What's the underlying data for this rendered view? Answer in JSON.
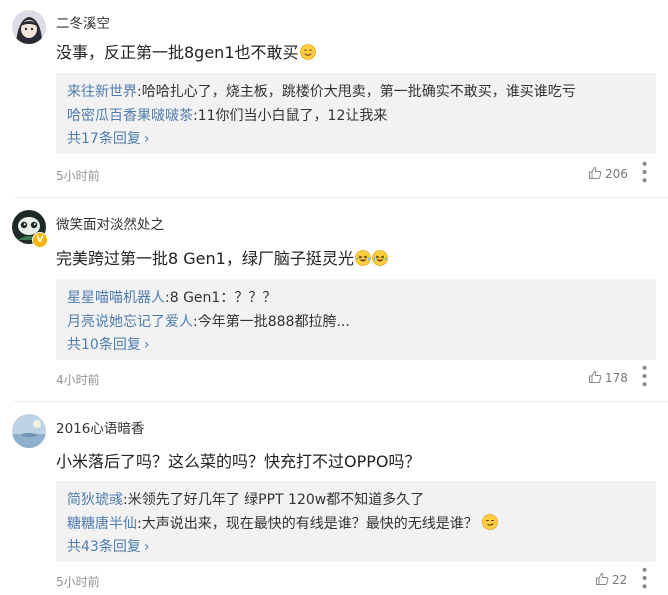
{
  "comments": [
    {
      "username": "二冬溪空",
      "content": "没事，反正第一批8gen1也不敢买",
      "content_emoji": "smile-emoji",
      "replies": [
        {
          "user": "来往新世界",
          "sep": ":",
          "text": "哈哈扎心了，烧主板，跳楼价大甩卖，第一批确实不敢买，谁买谁吃亏"
        },
        {
          "user": "哈密瓜百香果啵啵茶",
          "sep": ":",
          "text": "11你们当小白鼠了，12让我来"
        }
      ],
      "more_replies": "共17条回复",
      "time": "5小时前",
      "likes": "206"
    },
    {
      "username": "微笑面对淡然处之",
      "content": "完美跨过第一批8 Gen1，绿厂脑子挺灵光",
      "content_emoji": "laugh-cry-emoji",
      "verified": "V",
      "replies": [
        {
          "user": "星星喵喵机器人",
          "sep": ":",
          "text": "8 Gen1：？？？"
        },
        {
          "user": "月亮说她忘记了爱人",
          "sep": ":",
          "text": "今年第一批888都拉胯..."
        }
      ],
      "more_replies": "共10条回复",
      "time": "4小时前",
      "likes": "178"
    },
    {
      "username": "2016心语暗香",
      "content": "小米落后了吗？这么菜的吗？快充打不过OPPO吗？",
      "replies": [
        {
          "user": "简狄琥彧",
          "sep": ":",
          "text": "米领先了好几年了 绿PPT 120w都不知道多久了"
        },
        {
          "user": "糖糖唐半仙",
          "sep": ":",
          "text": "大声说出来，现在最快的有线是谁？最快的无线是谁？"
        }
      ],
      "more_replies": "共43条回复",
      "time": "5小时前",
      "likes": "22"
    }
  ],
  "icons": {
    "like": "thumbs-up-icon",
    "more": "more-dots-icon",
    "chevron": "chevron-right-icon"
  },
  "colors": {
    "link_blue": "#507daf",
    "reply_bg": "#f2f2f2",
    "meta_gray": "#939393"
  }
}
